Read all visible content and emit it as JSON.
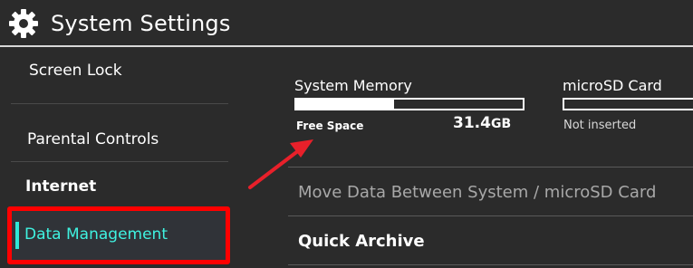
{
  "header": {
    "title": "System Settings",
    "icon": "gear-icon"
  },
  "sidebar": {
    "items": [
      {
        "label": "Screen Lock"
      },
      {
        "label": "Parental Controls"
      },
      {
        "label": "Internet"
      },
      {
        "label": "Data Management",
        "selected": true
      }
    ],
    "accent_color": "#2ee8d7",
    "highlight_border_color": "#ff0000"
  },
  "storage": {
    "system_memory": {
      "title": "System Memory",
      "free_label": "Free Space",
      "free_value": "31.4",
      "free_unit": "GB",
      "used_fraction": 0.43
    },
    "microsd": {
      "title": "microSD Card",
      "status": "Not inserted"
    }
  },
  "actions": {
    "move_data": "Move Data Between System / microSD Card",
    "quick_archive": "Quick Archive"
  },
  "annotation": {
    "arrow_color": "#e8202a"
  }
}
